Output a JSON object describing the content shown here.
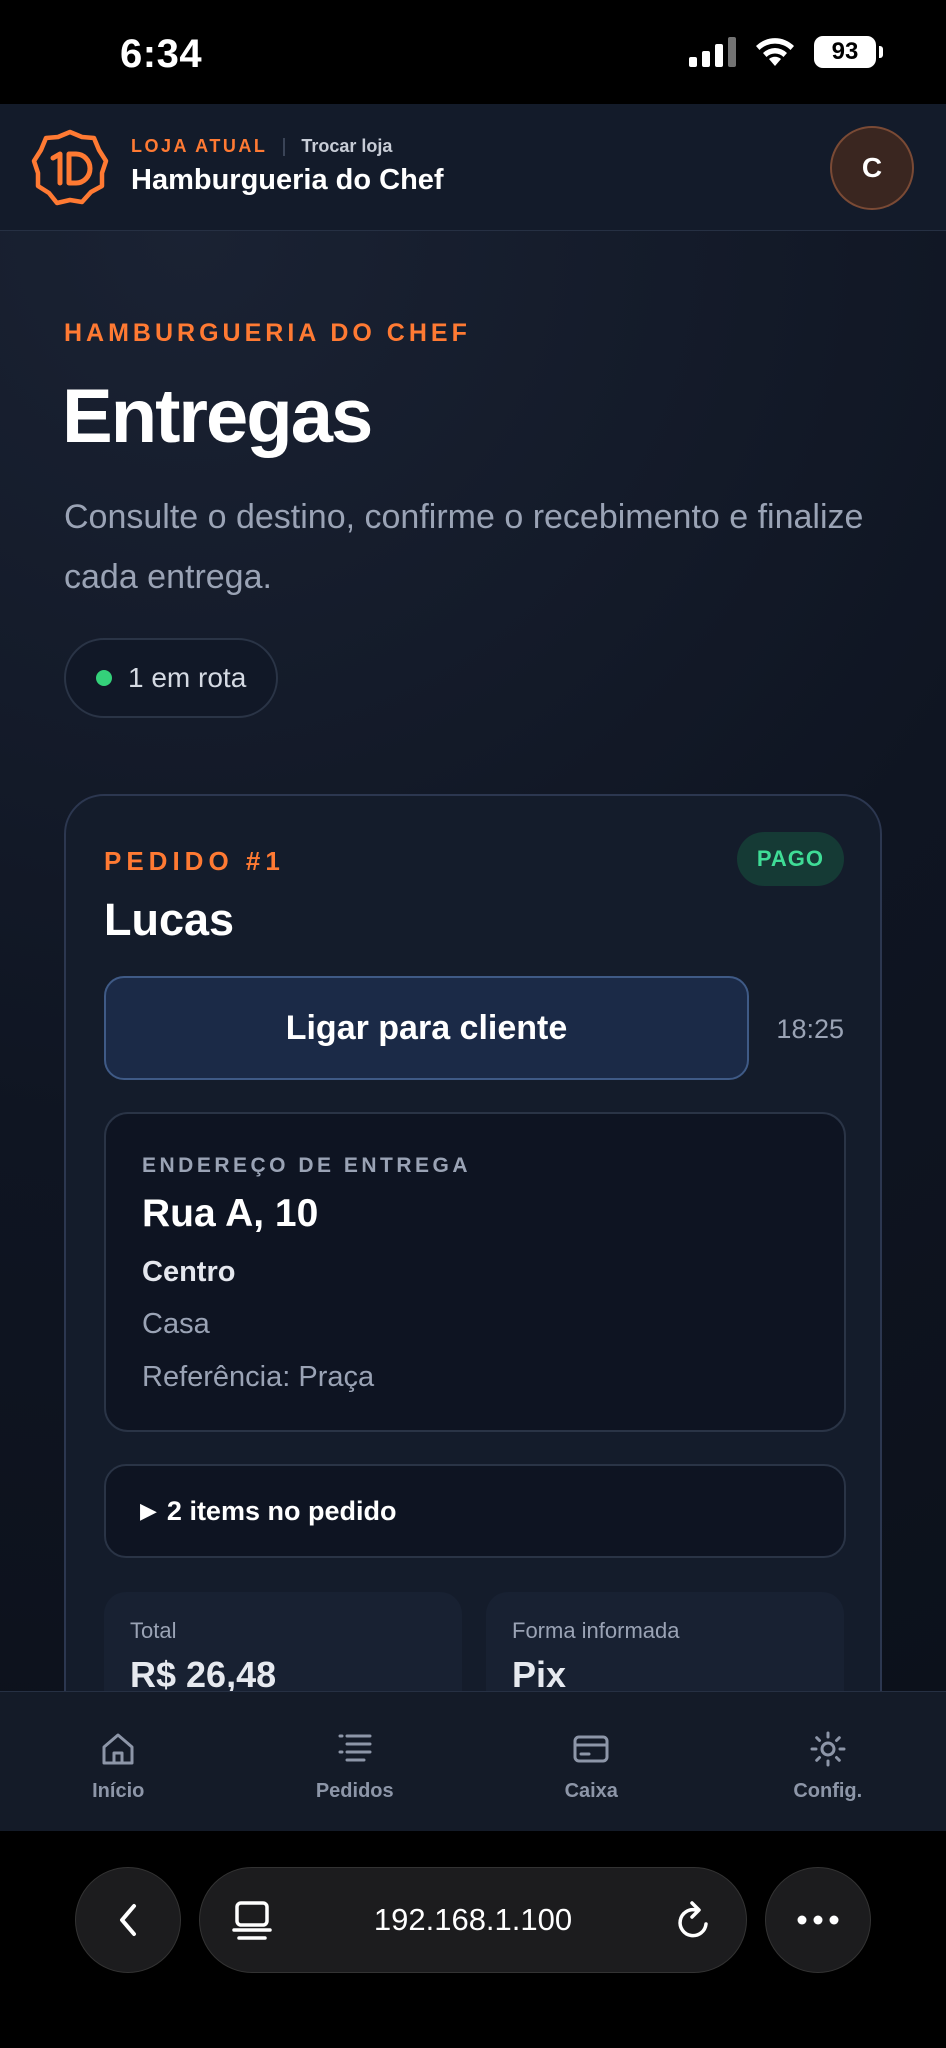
{
  "status_bar": {
    "time": "6:34",
    "battery": "93"
  },
  "header": {
    "store_label": "LOJA ATUAL",
    "switch_label": "Trocar loja",
    "store_name": "Hamburgueria do Chef",
    "avatar_initial": "C"
  },
  "page": {
    "eyebrow": "HAMBURGUERIA DO CHEF",
    "title": "Entregas",
    "description": "Consulte o destino, confirme o recebimento e finalize cada entrega.",
    "status_chip": "1 em rota"
  },
  "order": {
    "number_label": "PEDIDO #1",
    "payment_badge": "PAGO",
    "customer": "Lucas",
    "call_button": "Ligar para cliente",
    "time": "18:25",
    "address": {
      "label": "ENDEREÇO DE ENTREGA",
      "street": "Rua A, 10",
      "district": "Centro",
      "complement": "Casa",
      "reference": "Referência: Praça"
    },
    "items_summary": "2 items no pedido",
    "total_label": "Total",
    "total_value": "R$ 26,48",
    "payment_label": "Forma informada",
    "payment_value": "Pix"
  },
  "bottom_nav": [
    {
      "label": "Início",
      "icon": "home-icon"
    },
    {
      "label": "Pedidos",
      "icon": "list-icon"
    },
    {
      "label": "Caixa",
      "icon": "card-icon"
    },
    {
      "label": "Config.",
      "icon": "gear-icon"
    }
  ],
  "browser": {
    "url": "192.168.1.100"
  },
  "colors": {
    "accent": "#ff7a33",
    "success": "#34d17a",
    "background": "#0d1320",
    "card": "#141c2b"
  }
}
